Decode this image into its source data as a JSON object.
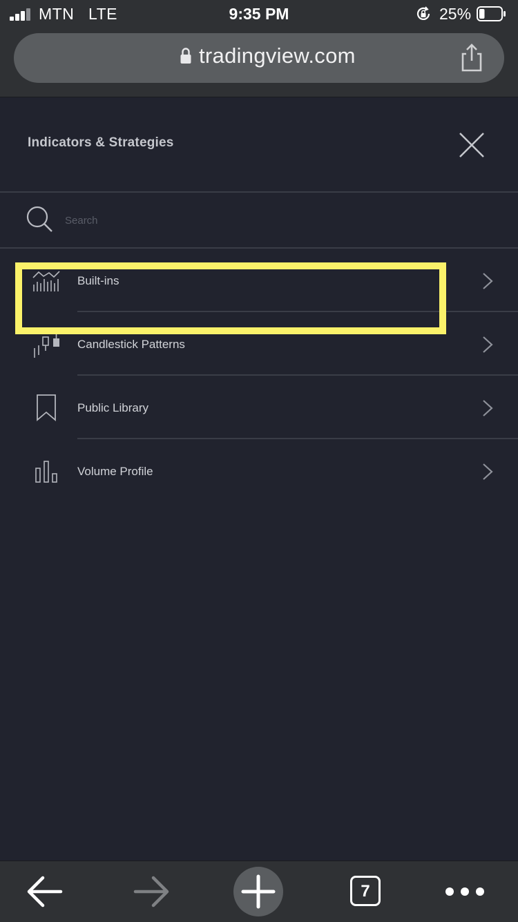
{
  "status_bar": {
    "carrier": "MTN",
    "network": "LTE",
    "time": "9:35 PM",
    "battery_percent": "25%",
    "battery_level": 0.25
  },
  "browser": {
    "url": "tradingview.com",
    "tab_count": "7"
  },
  "panel": {
    "title": "Indicators & Strategies",
    "search_placeholder": "Search",
    "items": [
      {
        "label": "Built-ins",
        "icon": "built-ins-chart-icon"
      },
      {
        "label": "Candlestick Patterns",
        "icon": "candlestick-icon"
      },
      {
        "label": "Public Library",
        "icon": "bookmark-icon"
      },
      {
        "label": "Volume Profile",
        "icon": "volume-bars-icon"
      }
    ]
  },
  "colors": {
    "background": "#21232e",
    "chrome": "#2f3134",
    "highlight": "#fbf26a",
    "divider": "#3a3d47"
  }
}
